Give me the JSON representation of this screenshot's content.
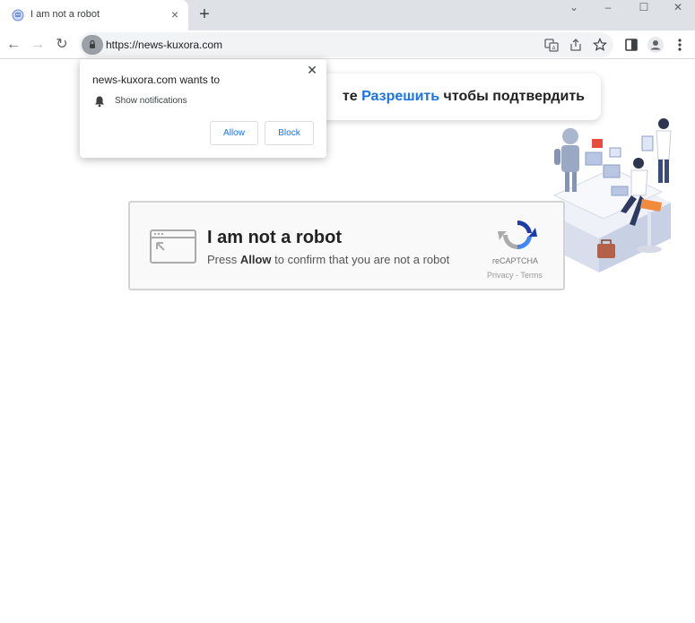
{
  "browser": {
    "tab": {
      "title": "I am not a robot",
      "favicon": "robot-favicon",
      "close_icon": "×"
    },
    "new_tab_icon": "+",
    "window_controls": {
      "chevron": "⌄",
      "minimize": "–",
      "maximize": "☐",
      "close": "✕"
    },
    "toolbar": {
      "back_icon": "←",
      "forward_icon": "→",
      "reload_icon": "↻",
      "url": "https://news-kuxora.com"
    }
  },
  "permission_popup": {
    "title": "news-kuxora.com wants to",
    "permission": "Show notifications",
    "allow_label": "Allow",
    "block_label": "Block",
    "close_icon": "✕"
  },
  "banner": {
    "text_prefix": "те ",
    "text_highlight": "Разрешить",
    "text_suffix": " чтобы подтвердить"
  },
  "captcha": {
    "title": "I am not a robot",
    "sub_prefix": "Press ",
    "sub_bold": "Allow",
    "sub_suffix": " to confirm that you are not a robot",
    "brand": "reCAPTCHA",
    "links": "Privacy - Terms"
  },
  "colors": {
    "accent": "#1a73e8",
    "tabstrip": "#dee1e6"
  }
}
